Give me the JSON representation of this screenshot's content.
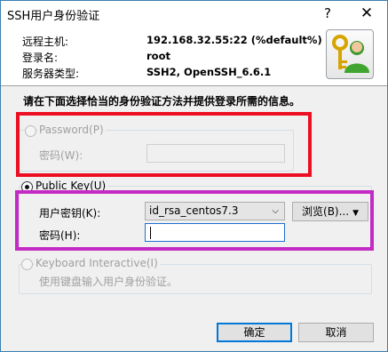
{
  "window": {
    "title": "SSH用户身份验证",
    "help": "?",
    "close": "✕"
  },
  "info": {
    "rows": [
      {
        "label": "远程主机:",
        "value": "192.168.32.55:22 (%default%)"
      },
      {
        "label": "登录名:",
        "value": "root"
      },
      {
        "label": "服务器类型:",
        "value": "SSH2, OpenSSH_6.6.1"
      }
    ],
    "icon": "keys-user-icon"
  },
  "instruction": "请在下面选择恰当的身份验证方法并提供登录所需的信息。",
  "password_group": {
    "label": "Password(P)",
    "field_label": "密码(W):",
    "value": "",
    "enabled": false
  },
  "pubkey_group": {
    "label": "Public Key(U)",
    "key_label": "用户密钥(K):",
    "key_value": "id_rsa_centos7.3",
    "browse": "浏览(B)...",
    "pass_label": "密码(H):",
    "pass_value": "",
    "selected": true
  },
  "kbd_group": {
    "label": "Keyboard Interactive(I)",
    "desc": "使用键盘输入用户身份验证。",
    "enabled": false
  },
  "buttons": {
    "ok": "确定",
    "cancel": "取消"
  },
  "annotations": {
    "red_color": "#ec0f22",
    "magenta_color": "#c22bc4"
  }
}
